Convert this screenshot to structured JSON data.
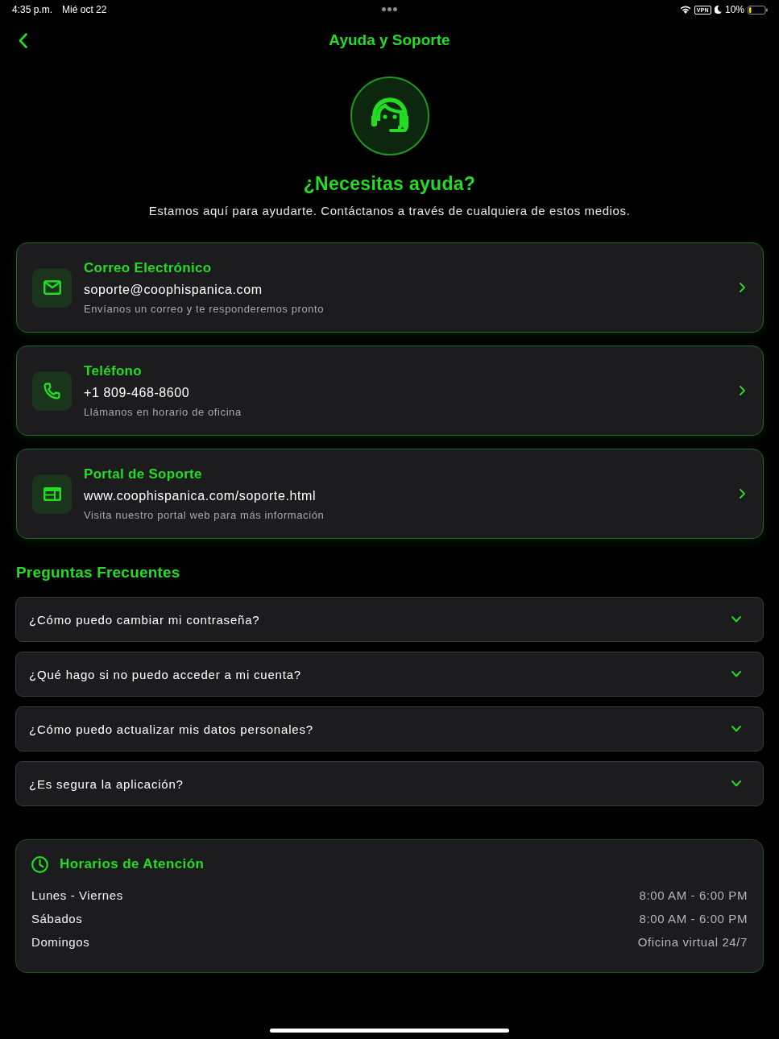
{
  "status_bar": {
    "time": "4:35 p.m.",
    "date": "Mié oct 22",
    "vpn": "VPN",
    "battery": "10%"
  },
  "nav": {
    "title": "Ayuda y Soporte"
  },
  "hero": {
    "heading": "¿Necesitas ayuda?",
    "subtitle": "Estamos aquí para ayudarte. Contáctanos a través de cualquiera de estos medios."
  },
  "contacts": [
    {
      "kind": "email",
      "title": "Correo Electrónico",
      "value": "soporte@coophispanica.com",
      "description": "Envíanos un correo y te responderemos pronto"
    },
    {
      "kind": "phone",
      "title": "Teléfono",
      "value": "+1 809-468-8600",
      "description": "Llámanos en horario de oficina"
    },
    {
      "kind": "web",
      "title": "Portal de Soporte",
      "value": "www.coophispanica.com/soporte.html",
      "description": "Visita nuestro portal web para más información"
    }
  ],
  "faq": {
    "title": "Preguntas Frecuentes",
    "items": [
      {
        "question": "¿Cómo puedo cambiar mi contraseña?",
        "expanded": false
      },
      {
        "question": "¿Qué hago si no puedo acceder a mi cuenta?",
        "expanded": false
      },
      {
        "question": "¿Cómo puedo actualizar mis datos personales?",
        "expanded": false
      },
      {
        "question": "¿Es segura la aplicación?",
        "expanded": false
      }
    ]
  },
  "hours": {
    "title": "Horarios de Atención",
    "rows": [
      {
        "days": "Lunes - Viernes",
        "time": "8:00 AM - 6:00 PM"
      },
      {
        "days": "Sábados",
        "time": "8:00 AM - 6:00 PM"
      },
      {
        "days": "Domingos",
        "time": "Oficina virtual 24/7"
      }
    ]
  }
}
